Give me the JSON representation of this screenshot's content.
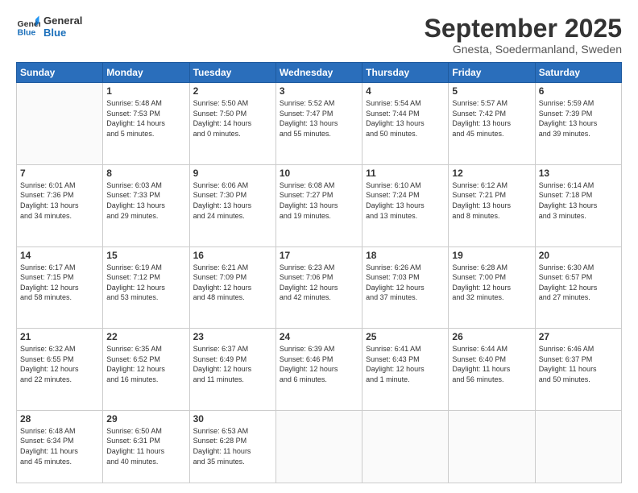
{
  "logo": {
    "line1": "General",
    "line2": "Blue"
  },
  "header": {
    "month": "September 2025",
    "location": "Gnesta, Soedermanland, Sweden"
  },
  "weekdays": [
    "Sunday",
    "Monday",
    "Tuesday",
    "Wednesday",
    "Thursday",
    "Friday",
    "Saturday"
  ],
  "weeks": [
    [
      {
        "day": "",
        "info": ""
      },
      {
        "day": "1",
        "info": "Sunrise: 5:48 AM\nSunset: 7:53 PM\nDaylight: 14 hours\nand 5 minutes."
      },
      {
        "day": "2",
        "info": "Sunrise: 5:50 AM\nSunset: 7:50 PM\nDaylight: 14 hours\nand 0 minutes."
      },
      {
        "day": "3",
        "info": "Sunrise: 5:52 AM\nSunset: 7:47 PM\nDaylight: 13 hours\nand 55 minutes."
      },
      {
        "day": "4",
        "info": "Sunrise: 5:54 AM\nSunset: 7:44 PM\nDaylight: 13 hours\nand 50 minutes."
      },
      {
        "day": "5",
        "info": "Sunrise: 5:57 AM\nSunset: 7:42 PM\nDaylight: 13 hours\nand 45 minutes."
      },
      {
        "day": "6",
        "info": "Sunrise: 5:59 AM\nSunset: 7:39 PM\nDaylight: 13 hours\nand 39 minutes."
      }
    ],
    [
      {
        "day": "7",
        "info": "Sunrise: 6:01 AM\nSunset: 7:36 PM\nDaylight: 13 hours\nand 34 minutes."
      },
      {
        "day": "8",
        "info": "Sunrise: 6:03 AM\nSunset: 7:33 PM\nDaylight: 13 hours\nand 29 minutes."
      },
      {
        "day": "9",
        "info": "Sunrise: 6:06 AM\nSunset: 7:30 PM\nDaylight: 13 hours\nand 24 minutes."
      },
      {
        "day": "10",
        "info": "Sunrise: 6:08 AM\nSunset: 7:27 PM\nDaylight: 13 hours\nand 19 minutes."
      },
      {
        "day": "11",
        "info": "Sunrise: 6:10 AM\nSunset: 7:24 PM\nDaylight: 13 hours\nand 13 minutes."
      },
      {
        "day": "12",
        "info": "Sunrise: 6:12 AM\nSunset: 7:21 PM\nDaylight: 13 hours\nand 8 minutes."
      },
      {
        "day": "13",
        "info": "Sunrise: 6:14 AM\nSunset: 7:18 PM\nDaylight: 13 hours\nand 3 minutes."
      }
    ],
    [
      {
        "day": "14",
        "info": "Sunrise: 6:17 AM\nSunset: 7:15 PM\nDaylight: 12 hours\nand 58 minutes."
      },
      {
        "day": "15",
        "info": "Sunrise: 6:19 AM\nSunset: 7:12 PM\nDaylight: 12 hours\nand 53 minutes."
      },
      {
        "day": "16",
        "info": "Sunrise: 6:21 AM\nSunset: 7:09 PM\nDaylight: 12 hours\nand 48 minutes."
      },
      {
        "day": "17",
        "info": "Sunrise: 6:23 AM\nSunset: 7:06 PM\nDaylight: 12 hours\nand 42 minutes."
      },
      {
        "day": "18",
        "info": "Sunrise: 6:26 AM\nSunset: 7:03 PM\nDaylight: 12 hours\nand 37 minutes."
      },
      {
        "day": "19",
        "info": "Sunrise: 6:28 AM\nSunset: 7:00 PM\nDaylight: 12 hours\nand 32 minutes."
      },
      {
        "day": "20",
        "info": "Sunrise: 6:30 AM\nSunset: 6:57 PM\nDaylight: 12 hours\nand 27 minutes."
      }
    ],
    [
      {
        "day": "21",
        "info": "Sunrise: 6:32 AM\nSunset: 6:55 PM\nDaylight: 12 hours\nand 22 minutes."
      },
      {
        "day": "22",
        "info": "Sunrise: 6:35 AM\nSunset: 6:52 PM\nDaylight: 12 hours\nand 16 minutes."
      },
      {
        "day": "23",
        "info": "Sunrise: 6:37 AM\nSunset: 6:49 PM\nDaylight: 12 hours\nand 11 minutes."
      },
      {
        "day": "24",
        "info": "Sunrise: 6:39 AM\nSunset: 6:46 PM\nDaylight: 12 hours\nand 6 minutes."
      },
      {
        "day": "25",
        "info": "Sunrise: 6:41 AM\nSunset: 6:43 PM\nDaylight: 12 hours\nand 1 minute."
      },
      {
        "day": "26",
        "info": "Sunrise: 6:44 AM\nSunset: 6:40 PM\nDaylight: 11 hours\nand 56 minutes."
      },
      {
        "day": "27",
        "info": "Sunrise: 6:46 AM\nSunset: 6:37 PM\nDaylight: 11 hours\nand 50 minutes."
      }
    ],
    [
      {
        "day": "28",
        "info": "Sunrise: 6:48 AM\nSunset: 6:34 PM\nDaylight: 11 hours\nand 45 minutes."
      },
      {
        "day": "29",
        "info": "Sunrise: 6:50 AM\nSunset: 6:31 PM\nDaylight: 11 hours\nand 40 minutes."
      },
      {
        "day": "30",
        "info": "Sunrise: 6:53 AM\nSunset: 6:28 PM\nDaylight: 11 hours\nand 35 minutes."
      },
      {
        "day": "",
        "info": ""
      },
      {
        "day": "",
        "info": ""
      },
      {
        "day": "",
        "info": ""
      },
      {
        "day": "",
        "info": ""
      }
    ]
  ]
}
